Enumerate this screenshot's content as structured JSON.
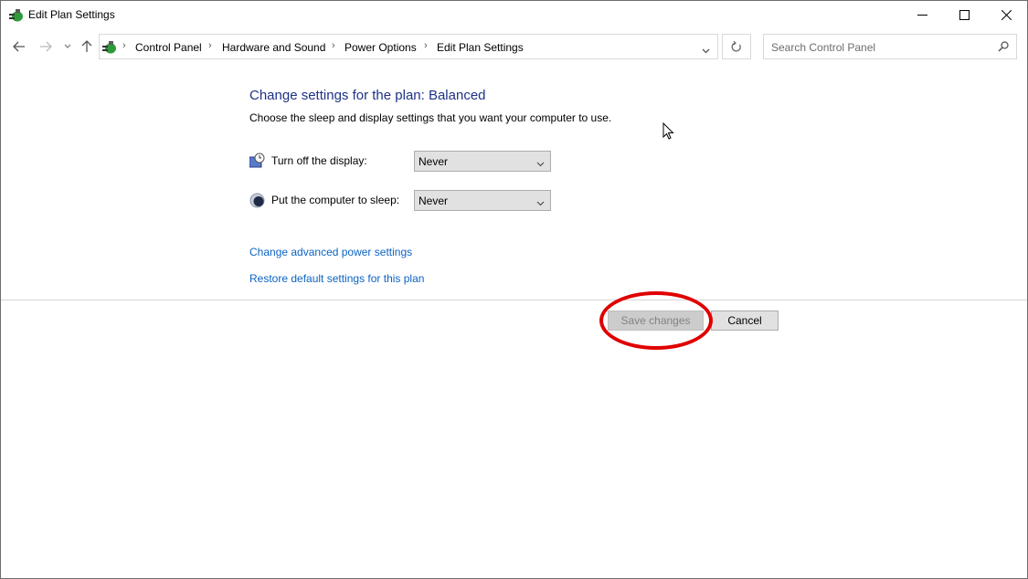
{
  "window": {
    "title": "Edit Plan Settings",
    "controls": [
      "minimize",
      "maximize",
      "close"
    ]
  },
  "navigation": {
    "back": "back-arrow",
    "forward": "forward-arrow",
    "recent": "chevron-down",
    "up": "up-arrow",
    "breadcrumbs": [
      "Control Panel",
      "Hardware and Sound",
      "Power Options",
      "Edit Plan Settings"
    ],
    "search_placeholder": "Search Control Panel"
  },
  "main": {
    "heading": "Change settings for the plan: Balanced",
    "description": "Choose the sleep and display settings that you want your computer to use.",
    "settings": [
      {
        "label": "Turn off the display:",
        "value": "Never",
        "icon": "display-clock-icon"
      },
      {
        "label": "Put the computer to sleep:",
        "value": "Never",
        "icon": "sleep-moon-icon"
      }
    ],
    "links": [
      "Change advanced power settings",
      "Restore default settings for this plan"
    ],
    "buttons": {
      "save": "Save changes",
      "cancel": "Cancel"
    },
    "save_enabled": false
  },
  "annotation": {
    "shape": "ellipse",
    "color": "#e00000",
    "target": "Save changes"
  }
}
